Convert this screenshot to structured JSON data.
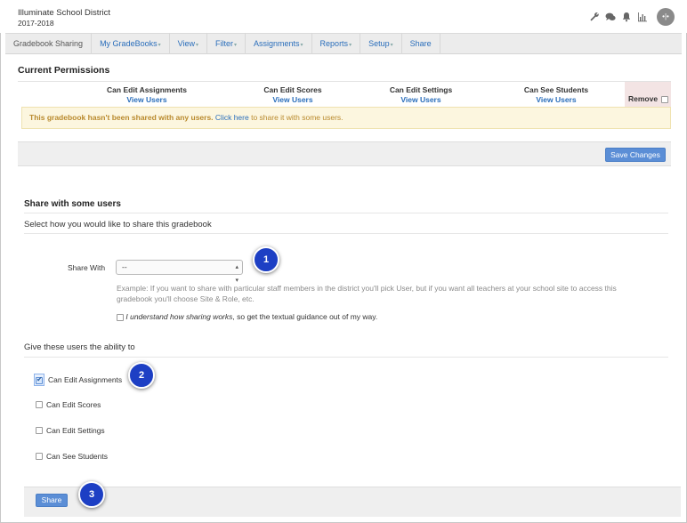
{
  "header": {
    "district": "Illuminate School District",
    "year": "2017-2018",
    "avatar_initials": "•|•",
    "icons": [
      "wrench-icon",
      "chat-icon",
      "bell-icon",
      "bar-chart-icon"
    ]
  },
  "nav": {
    "items": [
      {
        "label": "Gradebook Sharing",
        "caret": false
      },
      {
        "label": "My GradeBooks",
        "caret": true
      },
      {
        "label": "View",
        "caret": true
      },
      {
        "label": "Filter",
        "caret": true
      },
      {
        "label": "Assignments",
        "caret": true
      },
      {
        "label": "Reports",
        "caret": true
      },
      {
        "label": "Setup",
        "caret": true
      },
      {
        "label": "Share",
        "caret": false
      }
    ]
  },
  "permissions": {
    "title": "Current Permissions",
    "columns": [
      {
        "label": "Can Edit Assignments",
        "link": "View Users"
      },
      {
        "label": "Can Edit Scores",
        "link": "View Users"
      },
      {
        "label": "Can Edit Settings",
        "link": "View Users"
      },
      {
        "label": "Can See Students",
        "link": "View Users"
      }
    ],
    "remove_label": "Remove",
    "alert_bold": "This gradebook hasn't been shared with any users.",
    "alert_link": "Click here",
    "alert_rest": " to share it with some users.",
    "save_label": "Save Changes"
  },
  "share": {
    "title": "Share with some users",
    "subtitle": "Select how you would like to share this gradebook",
    "share_with_label": "Share With",
    "share_with_value": "--",
    "help_text": "Example: If you want to share with particular staff members in the district you'll pick User, but if you want all teachers at your school site to access this gradebook you'll choose Site & Role, etc.",
    "understand_italic": "I understand how sharing works",
    "understand_rest": ", so get the textual guidance out of my way.",
    "ability_title": "Give these users the ability to",
    "abilities": [
      {
        "label": "Can Edit Assignments",
        "checked": true
      },
      {
        "label": "Can Edit Scores",
        "checked": false
      },
      {
        "label": "Can Edit Settings",
        "checked": false
      },
      {
        "label": "Can See Students",
        "checked": false
      }
    ],
    "share_button": "Share"
  },
  "callouts": [
    "1",
    "2",
    "3"
  ],
  "colors": {
    "link": "#2a6ebb",
    "primary_button": "#5b8ed6",
    "alert_bg": "#fcf6df",
    "callout": "#1d3fc4"
  }
}
